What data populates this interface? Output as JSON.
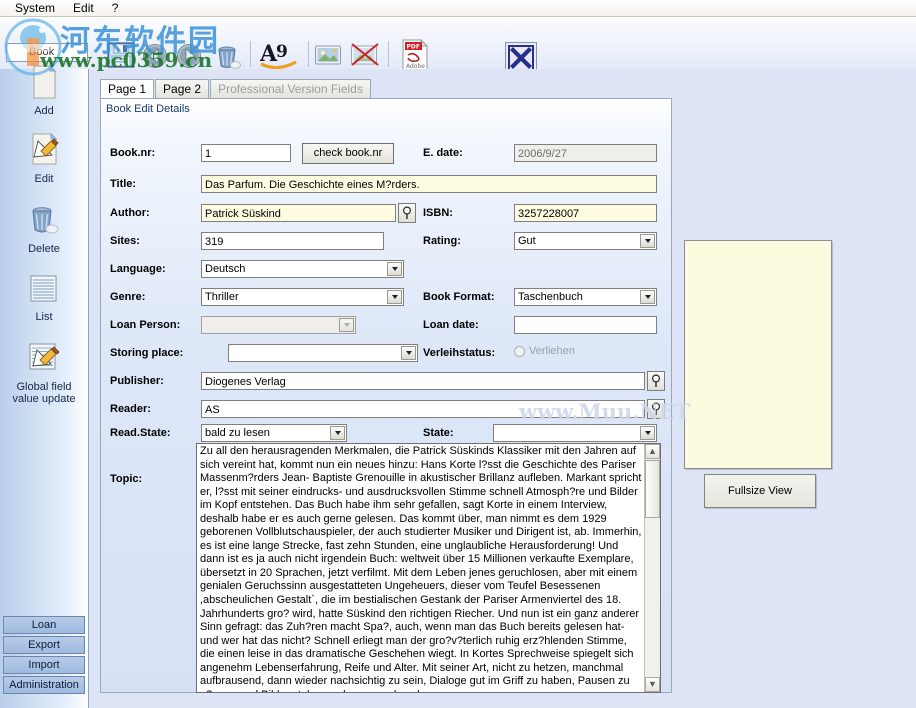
{
  "menubar": {
    "items": [
      {
        "label": "System"
      },
      {
        "label": "Edit"
      },
      {
        "label": "?"
      }
    ]
  },
  "toolbar": {
    "record_type": "Book",
    "buttons": [
      {
        "name": "save-icon",
        "label": "Save"
      },
      {
        "name": "back-icon",
        "label": "Back"
      },
      {
        "name": "forward-icon",
        "label": "Forward"
      },
      {
        "name": "delete-icon",
        "label": "Delete"
      },
      {
        "name": "font-icon",
        "label": "A9"
      },
      {
        "name": "image-icon",
        "label": "Picture"
      },
      {
        "name": "image-remove-icon",
        "label": "Remove Picture"
      },
      {
        "name": "pdf-icon",
        "label": "PDF"
      },
      {
        "name": "close-icon",
        "label": "Close"
      }
    ]
  },
  "sidebar": {
    "items": [
      {
        "label": "Add",
        "icon": "add-icon"
      },
      {
        "label": "Edit",
        "icon": "edit-icon"
      },
      {
        "label": "Delete",
        "icon": "delete-icon"
      },
      {
        "label": "List",
        "icon": "list-icon"
      },
      {
        "label": "Global field\nvalue update",
        "label_line1": "Global field",
        "label_line2": "value update",
        "icon": "global-update-icon"
      }
    ],
    "buttons": [
      {
        "label": "Loan"
      },
      {
        "label": "Export"
      },
      {
        "label": "Import"
      },
      {
        "label": "Administration"
      }
    ]
  },
  "tabs": [
    {
      "label": "Page 1",
      "state": "active"
    },
    {
      "label": "Page 2",
      "state": "normal"
    },
    {
      "label": "Professional Version Fields",
      "state": "disabled"
    }
  ],
  "form": {
    "caption": "Book Edit Details",
    "labels": {
      "booknr": "Book.nr:",
      "edate": "E. date:",
      "title": "Title:",
      "author": "Author:",
      "isbn": "ISBN:",
      "sites": "Sites:",
      "rating": "Rating:",
      "language": "Language:",
      "genre": "Genre:",
      "bookformat": "Book Format:",
      "loanperson": "Loan Person:",
      "loandate": "Loan date:",
      "storingplace": "Storing place:",
      "verleihstatus": "Verleihstatus:",
      "publisher": "Publisher:",
      "reader": "Reader:",
      "readstate": "Read.State:",
      "state": "State:",
      "topic": "Topic:"
    },
    "values": {
      "booknr": "1",
      "edate": "2006/9/27",
      "title": "Das Parfum. Die Geschichte eines M?rders.",
      "author": "Patrick Süskind",
      "isbn": "3257228007",
      "sites": "319",
      "rating": "Gut",
      "language": "Deutsch",
      "genre": "Thriller",
      "bookformat": "Taschenbuch",
      "loanperson": "",
      "loandate": "",
      "storingplace": "",
      "verleihstatus_label": "Verliehen",
      "verleihstatus_checked": false,
      "publisher": "Diogenes Verlag",
      "reader": "AS",
      "readstate": "bald zu lesen",
      "state": "",
      "topic": "Zu all den herausragenden Merkmalen, die Patrick Süskinds Klassiker mit den Jahren auf sich vereint hat, kommt nun ein neues hinzu: Hans Korte l?sst die Geschichte des Pariser Massenm?rders Jean- Baptiste Grenouille in akustischer Brillanz aufleben. Markant spricht er, l?sst mit seiner eindrucks- und ausdrucksvollen Stimme schnell Atmosph?re und Bilder im Kopf entstehen.  Das Buch habe ihm sehr gefallen, sagt  Korte in einem Interview, deshalb habe er es auch gerne gelesen. Das kommt über, man nimmt es dem 1929 geborenen Vollblutschauspieler, der auch studierter Musiker und Dirigent ist, ab. Immerhin, es ist eine lange Strecke, fast zehn Stunden, eine unglaubliche Herausforderung! Und dann ist es ja auch nicht irgendein Buch: weltweit über 15 Millionen verkaufte Exemplare, übersetzt in 20 Sprachen, jetzt verfilmt. Mit dem Leben jenes geruchlosen, aber mit einem genialen Geruchssinn ausgestatteten Ungeheuers, dieser vom Teufel Besessenen ,abscheulichen Gestalt`, die im bestialischen Gestank der Pariser Armenviertel des 18. Jahrhunderts gro? wird, hatte Süskind den richtigen Riecher. Und nun ist ein ganz anderer Sinn gefragt: das Zuh?ren macht Spa?, auch, wenn man das Buch bereits gelesen hat- und wer hat das nicht? Schnell erliegt man der gro?v?terlich ruhig erz?hlenden Stimme, die einen leise in das dramatische Geschehen wiegt. In Kortes Sprechweise spiegelt sich angenehm Lebenserfahrung, Reife und Alter. Mit seiner Art, nicht  zu hetzen, manchmal aufbrausend, dann wieder nachsichtig zu sein, Dialoge gut im Griff zu haben, Pausen zu g?nnen und Bilder stehen zu lassen und auch"
    },
    "buttons": {
      "check_booknr": "check book.nr"
    }
  },
  "preview": {
    "fullsize_button": "Fullsize View"
  },
  "watermark": {
    "cn": "河东软件园",
    "url": "www.pc0359.cn",
    "faint": "www.Muu.NET"
  },
  "colors": {
    "accent": "#2b3f8c",
    "panel": "#dce4f6",
    "field_yellow": "#fdfce1",
    "preview_bg": "#fcfbdf"
  }
}
